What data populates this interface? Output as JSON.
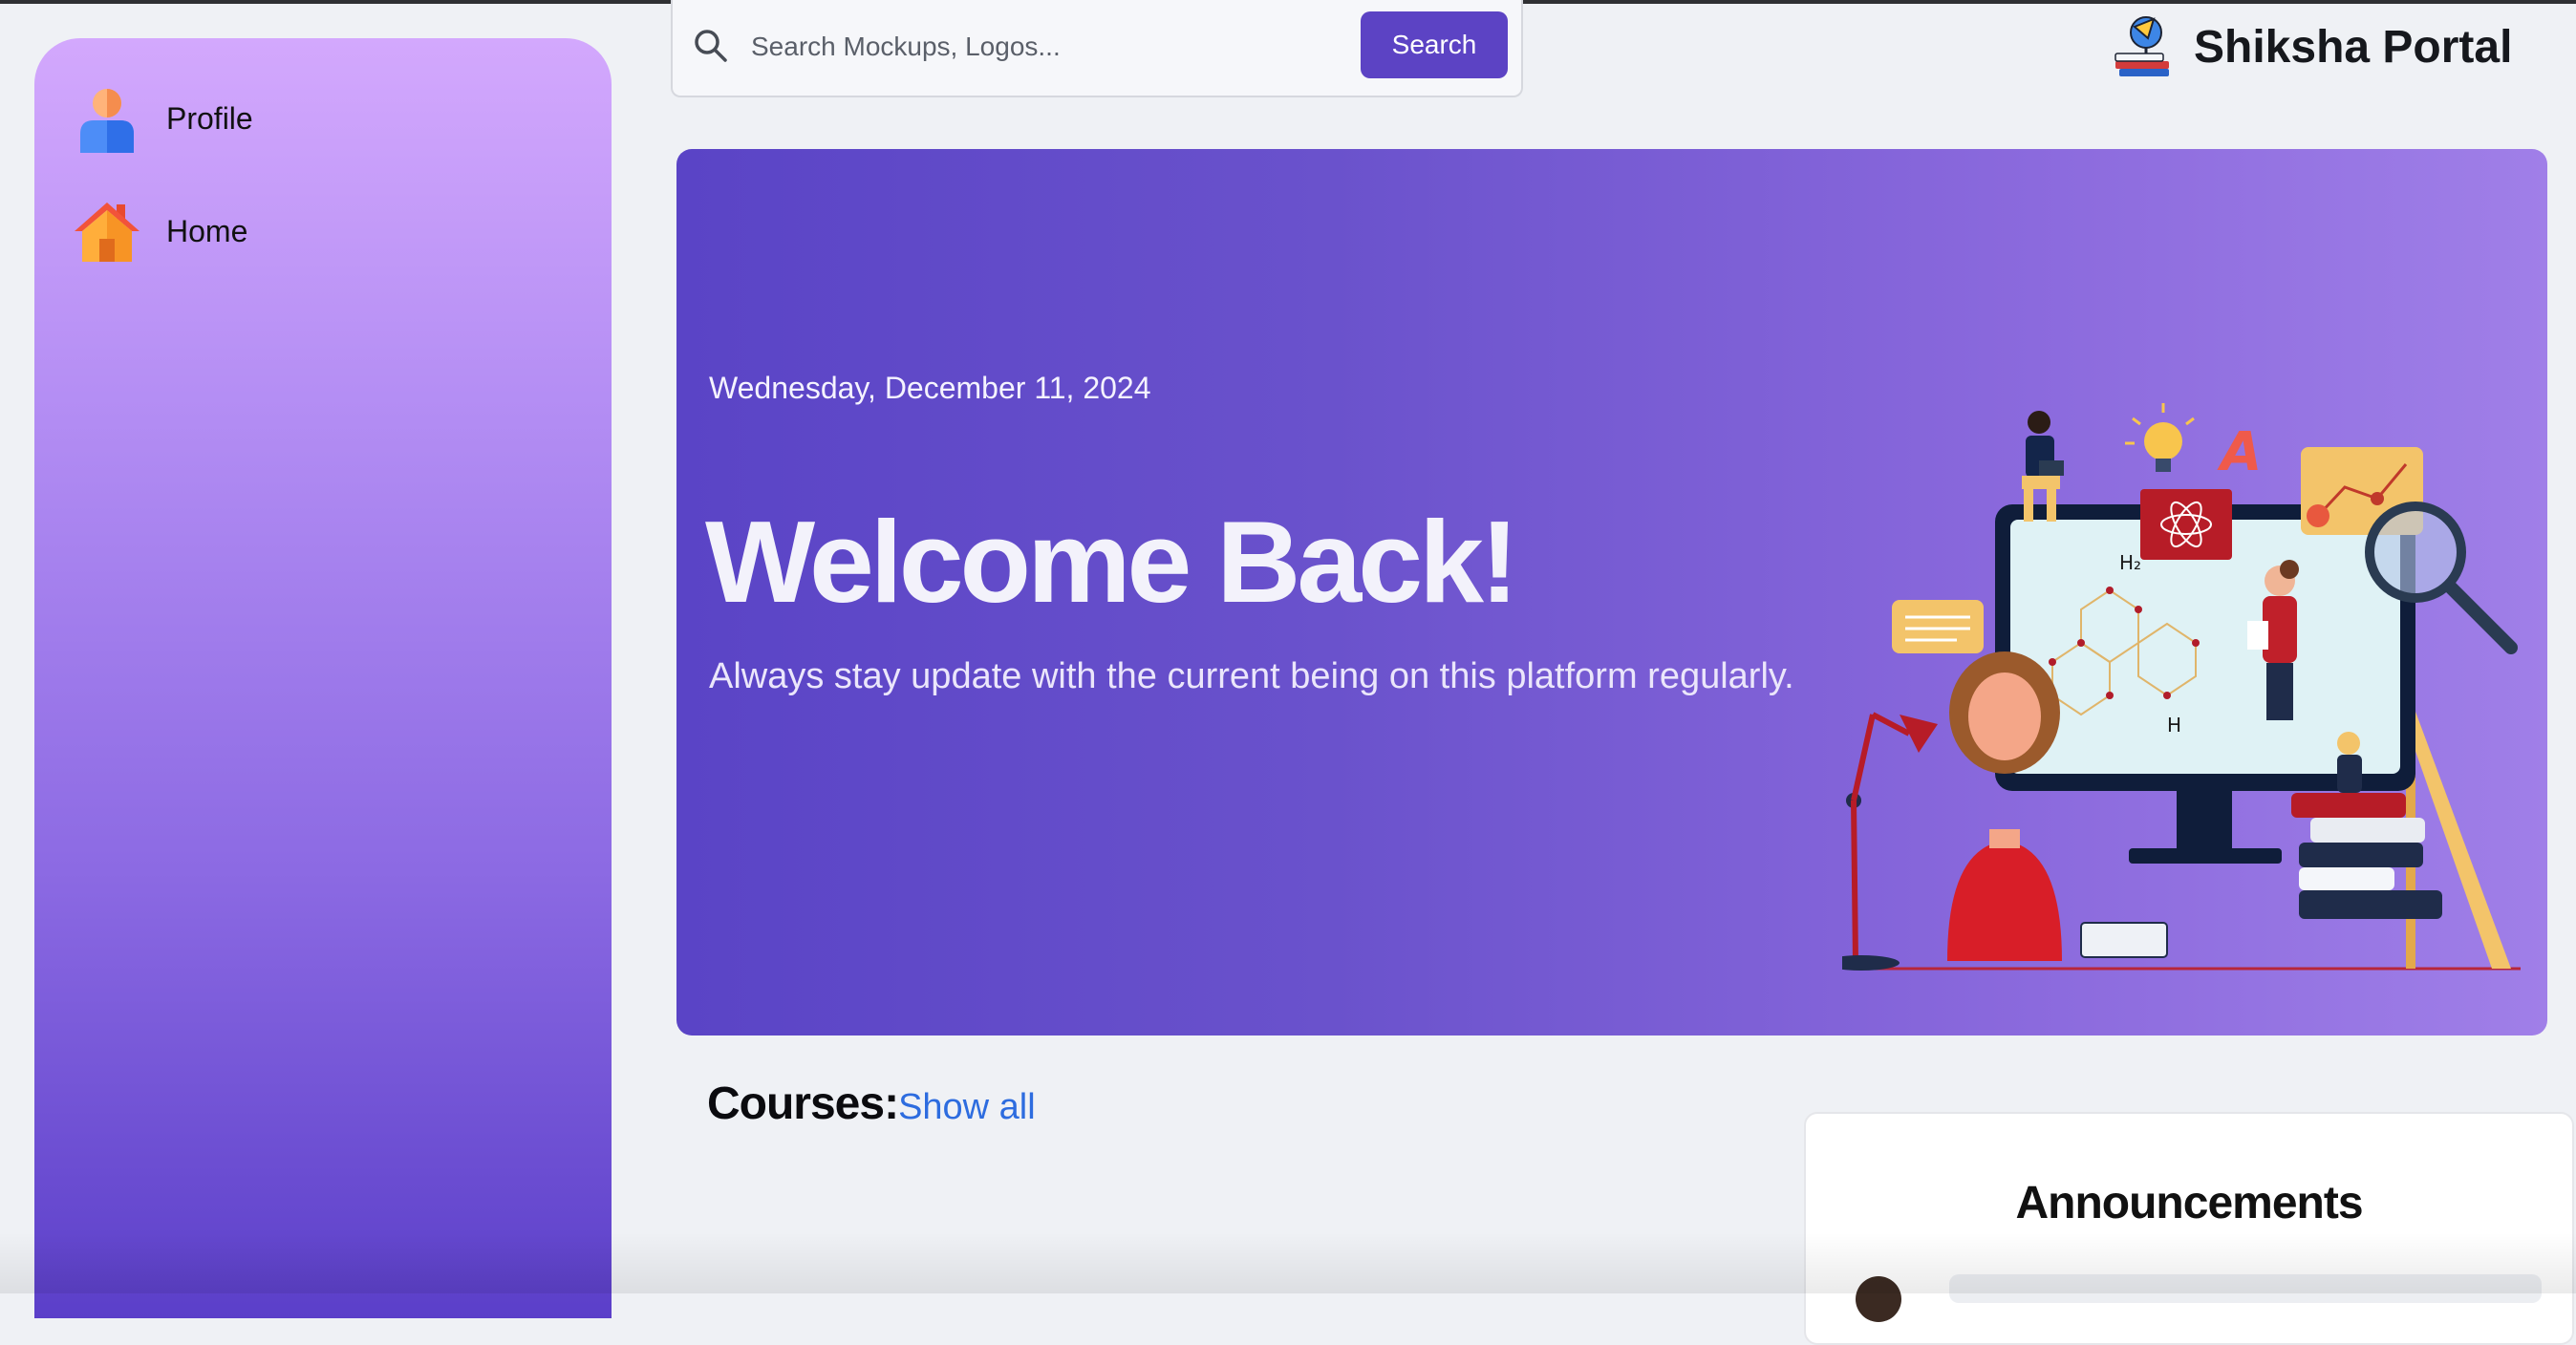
{
  "sidebar": {
    "items": [
      {
        "label": "Profile",
        "icon": "profile-icon"
      },
      {
        "label": "Home",
        "icon": "home-icon"
      }
    ],
    "gradient": [
      "#d3a8fd",
      "#5b3fc9"
    ]
  },
  "search": {
    "placeholder": "Search Mockups, Logos...",
    "value": "",
    "button_label": "Search",
    "icon": "search-icon"
  },
  "brand": {
    "name": "Shiksha Portal",
    "logo_icon": "graduation-rocket-icon"
  },
  "hero": {
    "date": "Wednesday, December 11, 2024",
    "title": "Welcome Back!",
    "subtitle": "Always stay update with the current being on this platform regularly.",
    "illustration": "education-illustration",
    "gradient": [
      "#5a44c6",
      "#a07fe8"
    ]
  },
  "courses": {
    "title": "Courses:",
    "show_all_label": "Show all"
  },
  "announcements": {
    "title": "Announcements"
  },
  "colors": {
    "accent": "#5c43c4",
    "link": "#2d6cdf",
    "background": "#eff1f5"
  }
}
